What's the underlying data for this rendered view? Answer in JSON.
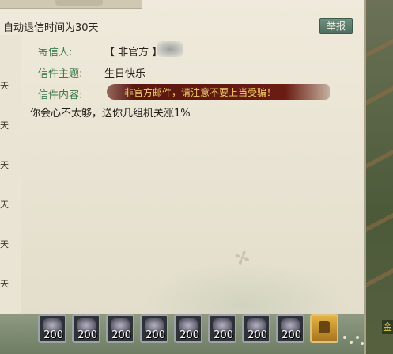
{
  "window": {
    "auto_return_notice": "自动退信时间为30天",
    "report_label": "举报"
  },
  "left_list": {
    "day_suffixes": [
      "天",
      "天",
      "天",
      "天",
      "天",
      "天"
    ]
  },
  "mail": {
    "sender_label": "寄信人:",
    "sender_value": "【 非官方 】",
    "subject_label": "信件主题:",
    "subject_value": "生日快乐",
    "content_label": "信件内容:",
    "warning_text": "非官方邮件，请注意不要上当受骗！",
    "body": "你会心不太够，送你几组机关涨1%"
  },
  "attachments": {
    "items": [
      {
        "icon": "gear-part-icon",
        "count": "200"
      },
      {
        "icon": "gear-part-icon",
        "count": "200"
      },
      {
        "icon": "gear-part-icon",
        "count": "200"
      },
      {
        "icon": "gear-part-icon",
        "count": "200"
      },
      {
        "icon": "gear-part-icon",
        "count": "200"
      },
      {
        "icon": "gear-part-icon",
        "count": "200"
      },
      {
        "icon": "gear-part-icon",
        "count": "200"
      },
      {
        "icon": "gear-part-icon",
        "count": "200"
      }
    ],
    "chest": {
      "icon": "treasure-chest-icon"
    }
  },
  "scene": {
    "edge_text": "金"
  },
  "colors": {
    "label_green": "#3f7a4a",
    "warning_bg": "#5a1610",
    "warning_text": "#f2d16a",
    "report_button": "#4f6e60"
  }
}
